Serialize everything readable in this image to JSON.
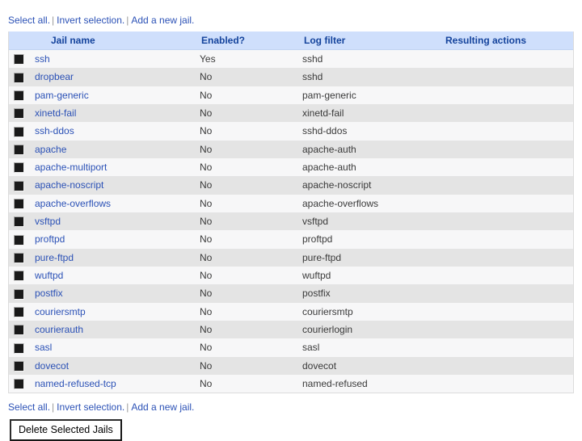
{
  "actions": {
    "select_all": "Select all.",
    "invert_selection": "Invert selection.",
    "add_new": "Add a new jail.",
    "separator": "|"
  },
  "table": {
    "columns": {
      "checkbox": "",
      "jail_name": "Jail name",
      "enabled": "Enabled?",
      "log_filter": "Log filter",
      "resulting_actions": "Resulting actions"
    },
    "rows": [
      {
        "name": "ssh",
        "enabled": "Yes",
        "log_filter": "sshd",
        "actions": ""
      },
      {
        "name": "dropbear",
        "enabled": "No",
        "log_filter": "sshd",
        "actions": ""
      },
      {
        "name": "pam-generic",
        "enabled": "No",
        "log_filter": "pam-generic",
        "actions": ""
      },
      {
        "name": "xinetd-fail",
        "enabled": "No",
        "log_filter": "xinetd-fail",
        "actions": ""
      },
      {
        "name": "ssh-ddos",
        "enabled": "No",
        "log_filter": "sshd-ddos",
        "actions": ""
      },
      {
        "name": "apache",
        "enabled": "No",
        "log_filter": "apache-auth",
        "actions": ""
      },
      {
        "name": "apache-multiport",
        "enabled": "No",
        "log_filter": "apache-auth",
        "actions": ""
      },
      {
        "name": "apache-noscript",
        "enabled": "No",
        "log_filter": "apache-noscript",
        "actions": ""
      },
      {
        "name": "apache-overflows",
        "enabled": "No",
        "log_filter": "apache-overflows",
        "actions": ""
      },
      {
        "name": "vsftpd",
        "enabled": "No",
        "log_filter": "vsftpd",
        "actions": ""
      },
      {
        "name": "proftpd",
        "enabled": "No",
        "log_filter": "proftpd",
        "actions": ""
      },
      {
        "name": "pure-ftpd",
        "enabled": "No",
        "log_filter": "pure-ftpd",
        "actions": ""
      },
      {
        "name": "wuftpd",
        "enabled": "No",
        "log_filter": "wuftpd",
        "actions": ""
      },
      {
        "name": "postfix",
        "enabled": "No",
        "log_filter": "postfix",
        "actions": ""
      },
      {
        "name": "couriersmtp",
        "enabled": "No",
        "log_filter": "couriersmtp",
        "actions": ""
      },
      {
        "name": "courierauth",
        "enabled": "No",
        "log_filter": "courierlogin",
        "actions": ""
      },
      {
        "name": "sasl",
        "enabled": "No",
        "log_filter": "sasl",
        "actions": ""
      },
      {
        "name": "dovecot",
        "enabled": "No",
        "log_filter": "dovecot",
        "actions": ""
      },
      {
        "name": "named-refused-tcp",
        "enabled": "No",
        "log_filter": "named-refused",
        "actions": ""
      }
    ]
  },
  "footer": {
    "delete_button": "Delete Selected Jails"
  },
  "colors": {
    "link": "#2b51b6",
    "header_bg": "#cfdffc",
    "header_text": "#14439c",
    "no_value": "#e8201f",
    "row_odd": "#f7f7f8",
    "row_even": "#e4e4e4"
  }
}
